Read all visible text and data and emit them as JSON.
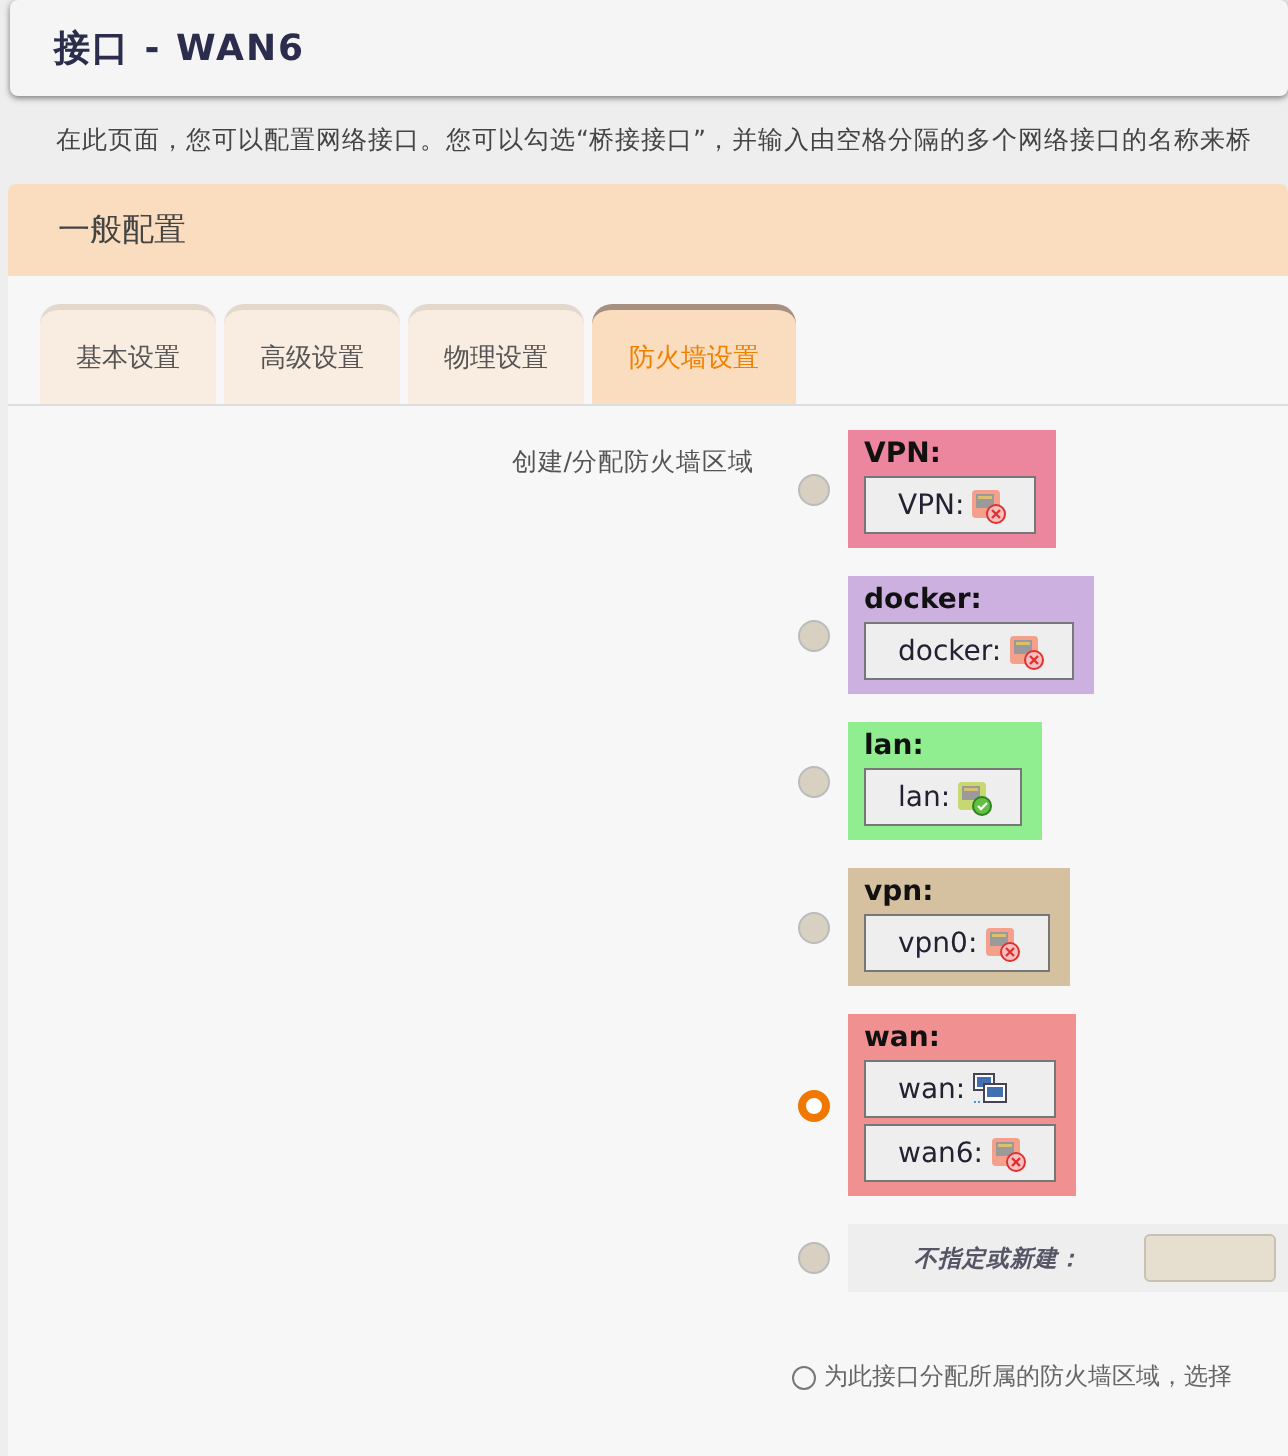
{
  "page_title": "接口 - WAN6",
  "description": "在此页面，您可以配置网络接口。您可以勾选“桥接接口”，并输入由空格分隔的多个网络接口的名称来桥",
  "section": {
    "title": "一般配置",
    "tabs": [
      {
        "label": "基本设置",
        "selected": false
      },
      {
        "label": "高级设置",
        "selected": false
      },
      {
        "label": "物理设置",
        "selected": false
      },
      {
        "label": "防火墙设置",
        "selected": true
      }
    ],
    "field_label": "创建/分配防火墙区域",
    "zones": [
      {
        "name": "VPN:",
        "color": "#ec869f",
        "selected": false,
        "interfaces": [
          {
            "name": "VPN:",
            "kind": "port-down"
          }
        ]
      },
      {
        "name": "docker:",
        "color": "#cbb0e0",
        "selected": false,
        "interfaces": [
          {
            "name": "docker:",
            "kind": "port-down"
          }
        ]
      },
      {
        "name": "lan:",
        "color": "#90ee90",
        "selected": false,
        "interfaces": [
          {
            "name": "lan:",
            "kind": "port-up"
          }
        ]
      },
      {
        "name": "vpn:",
        "color": "#d5c09f",
        "selected": false,
        "interfaces": [
          {
            "name": "vpn0:",
            "kind": "port-down"
          }
        ]
      },
      {
        "name": "wan:",
        "color": "#f09090",
        "selected": true,
        "interfaces": [
          {
            "name": "wan:",
            "kind": "network"
          },
          {
            "name": "wan6:",
            "kind": "port-down"
          }
        ]
      }
    ],
    "new_zone": {
      "label": "不指定或新建：",
      "selected": false
    },
    "help": "为此接口分配所属的防火墙区域，选择"
  }
}
